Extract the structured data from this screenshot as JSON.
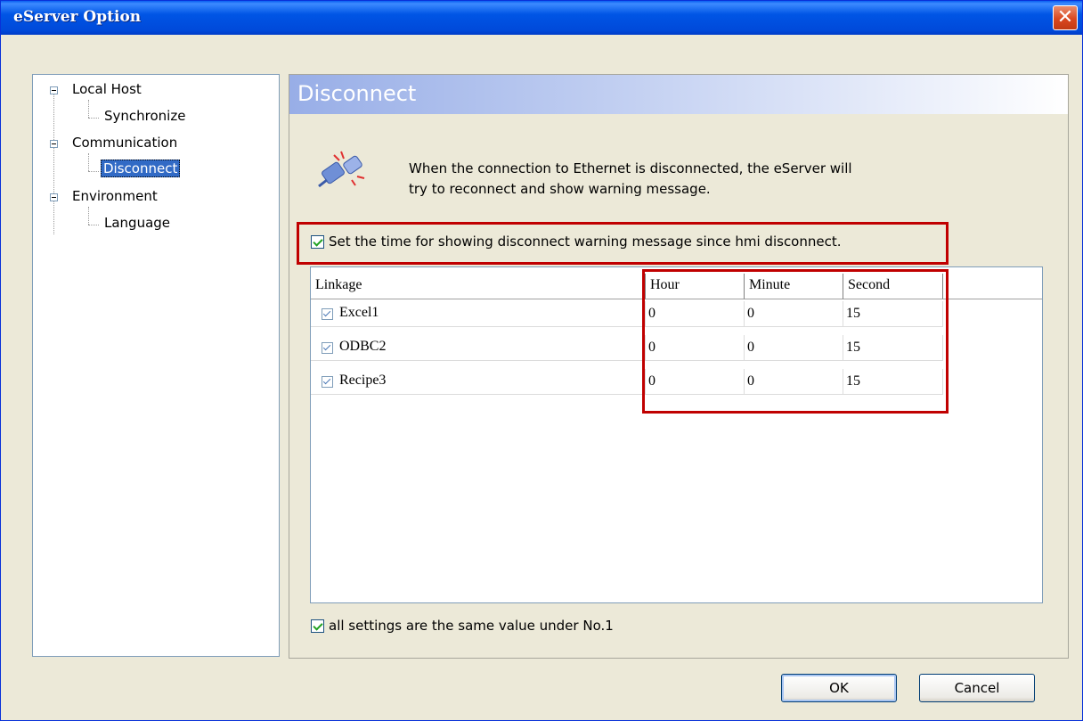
{
  "window": {
    "title": "eServer Option",
    "close_glyph": "✕"
  },
  "tree": {
    "items": [
      {
        "label": "Local Host"
      },
      {
        "label": "Synchronize"
      },
      {
        "label": "Communication"
      },
      {
        "label": "Disconnect"
      },
      {
        "label": "Environment"
      },
      {
        "label": "Language"
      }
    ]
  },
  "panel": {
    "title": "Disconnect",
    "icon": "disconnect-plug-icon",
    "description_line1": "When the connection to Ethernet is disconnected, the eServer will",
    "description_line2": "try to reconnect and show warning message.",
    "set_time_label": "Set the time for showing disconnect warning message since hmi disconnect.",
    "same_value_label": "all settings are the same value under No.1"
  },
  "table": {
    "columns": [
      "Linkage",
      "Hour",
      "Minute",
      "Second"
    ],
    "rows": [
      {
        "linkage": "Excel1",
        "hour": "0",
        "minute": "0",
        "second": "15"
      },
      {
        "linkage": "ODBC2",
        "hour": "0",
        "minute": "0",
        "second": "15"
      },
      {
        "linkage": "Recipe3",
        "hour": "0",
        "minute": "0",
        "second": "15"
      }
    ]
  },
  "buttons": {
    "ok": "OK",
    "cancel": "Cancel"
  },
  "colors": {
    "highlight": "#c00000",
    "selection": "#316ac5",
    "title_bar": "#0055e5"
  }
}
